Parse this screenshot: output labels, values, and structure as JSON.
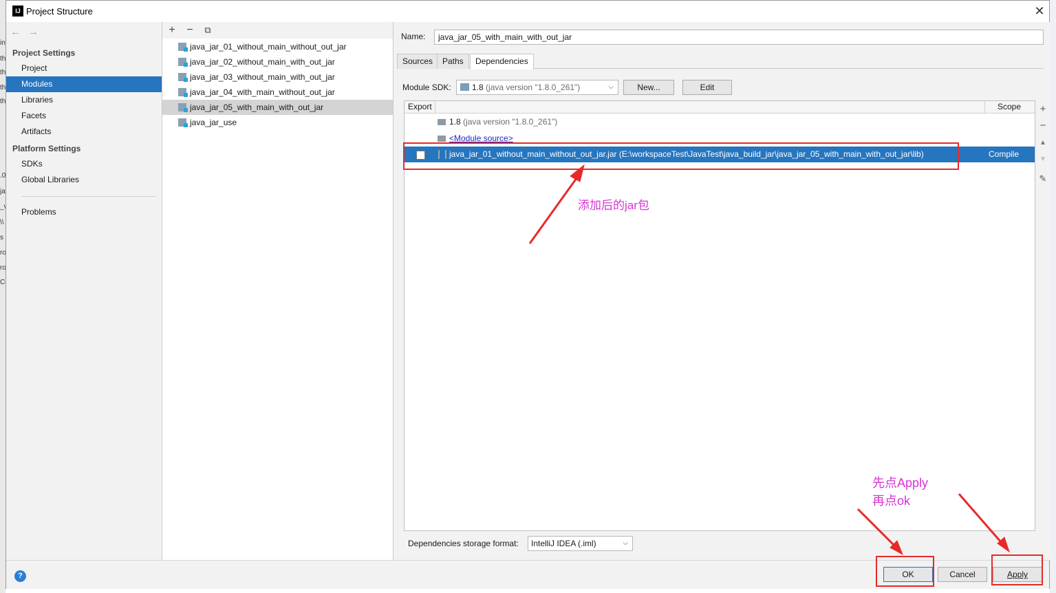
{
  "window": {
    "title": "Project Structure"
  },
  "background_text": [
    "in",
    "th",
    "th",
    "th",
    "th",
    ".0",
    "ja",
    "_v",
    "\\\\",
    "s",
    "ro",
    "ro",
    "Co"
  ],
  "sidebar": {
    "project_settings_title": "Project Settings",
    "project_items": [
      "Project",
      "Modules",
      "Libraries",
      "Facets",
      "Artifacts"
    ],
    "selected_item": "Modules",
    "platform_settings_title": "Platform Settings",
    "platform_items": [
      "SDKs",
      "Global Libraries"
    ],
    "problems": "Problems"
  },
  "modules": {
    "items": [
      "java_jar_01_without_main_without_out_jar",
      "java_jar_02_without_main_with_out_jar",
      "java_jar_03_without_main_with_out_jar",
      "java_jar_04_with_main_without_out_jar",
      "java_jar_05_with_main_with_out_jar",
      "java_jar_use"
    ],
    "selected": "java_jar_05_with_main_with_out_jar"
  },
  "detail": {
    "name_label": "Name:",
    "name_value": "java_jar_05_with_main_with_out_jar",
    "tabs": [
      "Sources",
      "Paths",
      "Dependencies"
    ],
    "active_tab": "Dependencies",
    "sdk_label": "Module SDK:",
    "sdk_version": "1.8",
    "sdk_detail": "(java version \"1.8.0_261\")",
    "new_button": "New...",
    "edit_button": "Edit",
    "table_headers": {
      "export": "Export",
      "scope": "Scope"
    },
    "dependencies": [
      {
        "version": "1.8",
        "detail": "(java version \"1.8.0_261\")"
      },
      {
        "text": "<Module source>"
      },
      {
        "text": "java_jar_01_without_main_without_out_jar.jar (E:\\workspaceTest\\JavaTest\\java_build_jar\\java_jar_05_with_main_with_out_jar\\lib)",
        "scope": "Compile",
        "checked": false
      }
    ],
    "storage_label": "Dependencies storage format:",
    "storage_value": "IntelliJ IDEA (.iml)"
  },
  "buttons": {
    "ok": "OK",
    "cancel": "Cancel",
    "apply": "Apply"
  },
  "annotations": {
    "jar_note": "添加后的jar包",
    "apply_note_line1": "先点Apply",
    "apply_note_line2": "再点ok"
  },
  "colors": {
    "selection": "#2675bf",
    "annotation_red": "#e52a2a",
    "annotation_text": "#d733d7"
  }
}
